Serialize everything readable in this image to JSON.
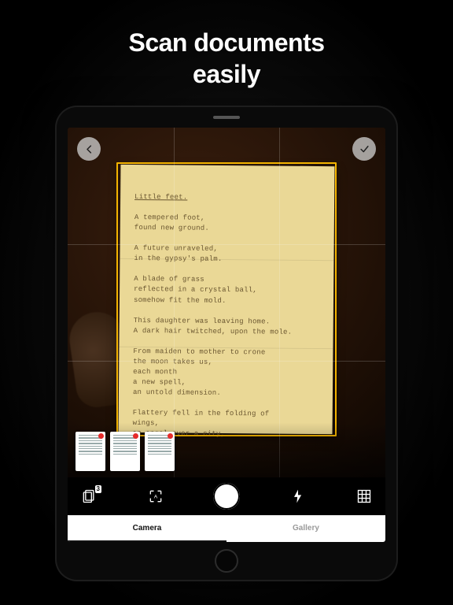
{
  "headline_line1": "Scan documents",
  "headline_line2": "easily",
  "top_buttons": {
    "back": "←",
    "confirm": "✓"
  },
  "document": {
    "title": "Little feet.",
    "stanzas": [
      "A tempered foot,\nfound new ground.",
      "A future unraveled,\nin the gypsy's palm.",
      "A blade of grass\nreflected in a crystal ball,\nsomehow fit the mold.",
      "This daughter was leaving home.\nA dark hair twitched, upon the mole.",
      "From maiden to mother to crone\nthe moon takes us,\neach month\na new spell,\nan untold dimension.",
      "Flattery fell in the folding of\nwings,\nan angel over a city,"
    ]
  },
  "thumbnails": [
    {
      "badge": true
    },
    {
      "badge": true
    },
    {
      "badge": true
    }
  ],
  "controls": {
    "batch_count": "3",
    "icons": {
      "batch": "batch",
      "auto_capture": "A",
      "flash": "flash",
      "grid": "grid"
    }
  },
  "tabs": [
    "Camera",
    "Gallery"
  ],
  "active_tab": "Camera"
}
